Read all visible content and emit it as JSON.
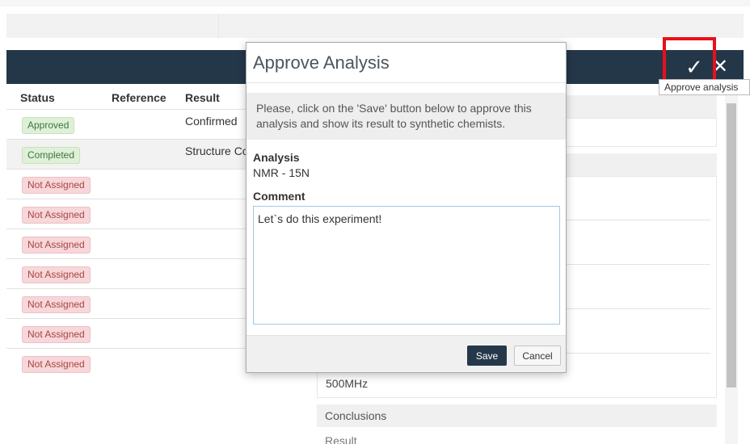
{
  "toolbar": {
    "approve_icon": "✓",
    "close_icon": "✕",
    "approve_tooltip": "Approve analysis"
  },
  "table": {
    "headers": {
      "status": "Status",
      "reference": "Reference",
      "result": "Result"
    },
    "rows": [
      {
        "status": "Approved",
        "status_color": "#dff0d8",
        "result": "Confirmed"
      },
      {
        "status": "Completed",
        "status_color": "#dff0d8",
        "result": "Structure Co"
      },
      {
        "status": "Not Assigned",
        "status_color": "#f7d7da",
        "result": ""
      },
      {
        "status": "Not Assigned",
        "status_color": "#f7d7da",
        "result": ""
      },
      {
        "status": "Not Assigned",
        "status_color": "#f7d7da",
        "result": ""
      },
      {
        "status": "Not Assigned",
        "status_color": "#f7d7da",
        "result": ""
      },
      {
        "status": "Not Assigned",
        "status_color": "#f7d7da",
        "result": ""
      },
      {
        "status": "Not Assigned",
        "status_color": "#f7d7da",
        "result": ""
      },
      {
        "status": "Not Assigned",
        "status_color": "#f7d7da",
        "result": ""
      }
    ]
  },
  "details": {
    "frequency": "500MHz",
    "conclusions_heading": "Conclusions",
    "result_label": "Result"
  },
  "modal": {
    "title": "Approve Analysis",
    "info": "Please, click on the 'Save' button below to approve this analysis and show its result to synthetic chemists.",
    "analysis_label": "Analysis",
    "analysis_value": "NMR - 15N",
    "comment_label": "Comment",
    "comment_value": "Let`s do this experiment!",
    "save_label": "Save",
    "cancel_label": "Cancel"
  },
  "colors": {
    "header": "#243749",
    "highlight": "#e8101a",
    "save_button": "#24384a"
  }
}
